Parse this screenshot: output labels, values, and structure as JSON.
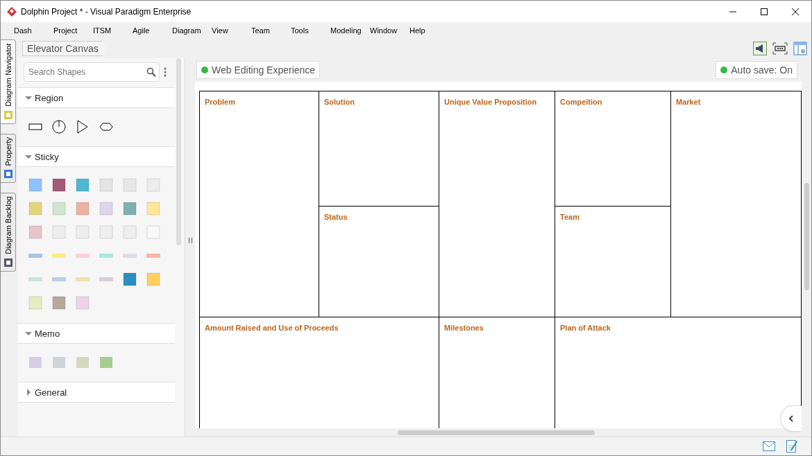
{
  "window": {
    "title": "Dolphin Project * - Visual Paradigm Enterprise"
  },
  "menu": [
    "Dash",
    "Project",
    "ITSM",
    "Agile",
    "Diagram",
    "View",
    "Team",
    "Tools",
    "Modeling",
    "Window",
    "Help"
  ],
  "side_tabs": [
    {
      "label": "Diagram Navigator",
      "selected": true
    },
    {
      "label": "Property",
      "selected": false
    },
    {
      "label": "Diagram Backlog",
      "selected": false
    }
  ],
  "breadcrumb": "Elevator Canvas",
  "search": {
    "placeholder": "Search Shapes"
  },
  "sections": [
    {
      "title": "Region",
      "expanded": true,
      "kind": "region"
    },
    {
      "title": "Sticky",
      "expanded": true,
      "kind": "sticky"
    },
    {
      "title": "Memo",
      "expanded": true,
      "kind": "memo"
    },
    {
      "title": "General",
      "expanded": false,
      "kind": "general"
    }
  ],
  "status_badges": [
    {
      "label": "Web Editing Experience",
      "color": "#33bb44"
    },
    {
      "label": "Auto save: On",
      "color": "#33bb44"
    }
  ],
  "canvas_blocks": [
    "Problem",
    "Solution",
    "Unique Value Proposition",
    "Compeition",
    "Market",
    "Status",
    "Team",
    "Amount Raised and Use of Proceeds",
    "Milestones",
    "Plan of Attack"
  ]
}
